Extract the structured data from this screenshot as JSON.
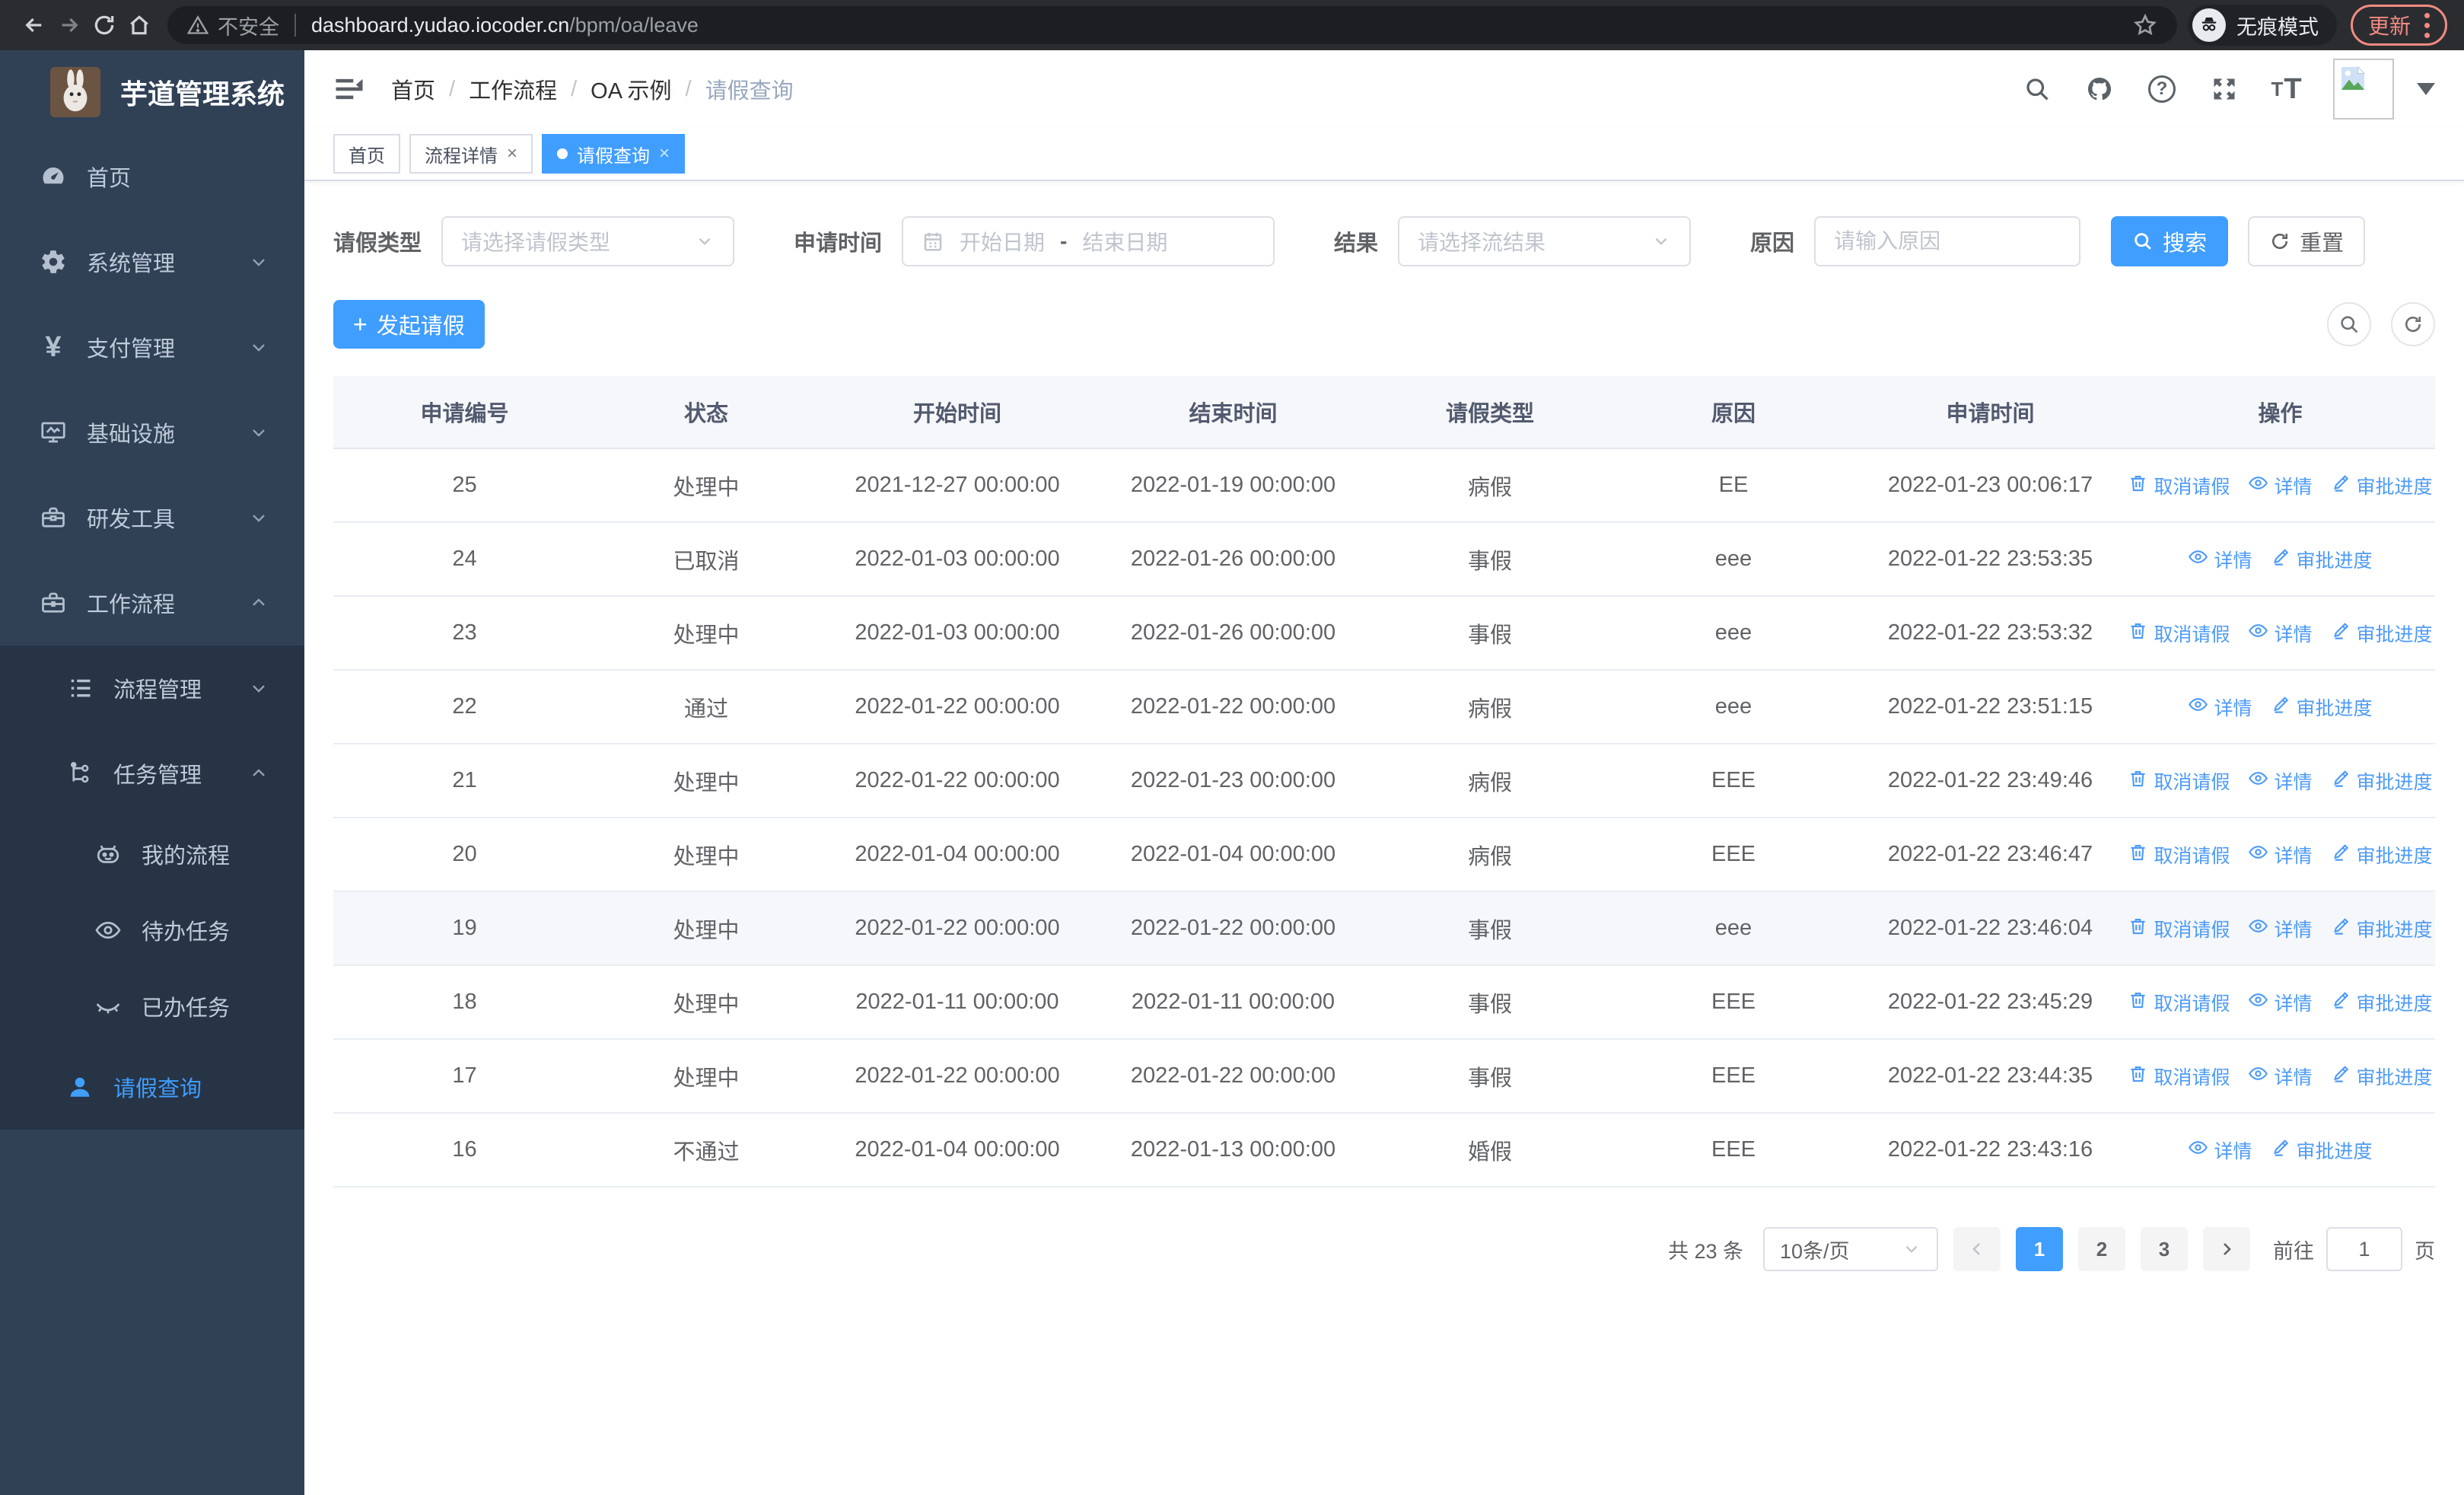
{
  "browser": {
    "security_label": "不安全",
    "url_host": "dashboard.yudao.iocoder.cn",
    "url_path": "/bpm/oa/leave",
    "incognito_label": "无痕模式",
    "update_label": "更新"
  },
  "colors": {
    "primary": "#409EFF",
    "sidebar_bg": "#304156",
    "submenu_bg": "#263445",
    "coral": "#f28b82"
  },
  "sidebar": {
    "title": "芋道管理系统",
    "items": [
      {
        "label": "首页",
        "icon": "dashboard-icon",
        "level": 1,
        "sub": false,
        "chevron": null,
        "active": false
      },
      {
        "label": "系统管理",
        "icon": "gear-icon",
        "level": 1,
        "sub": false,
        "chevron": "down",
        "active": false
      },
      {
        "label": "支付管理",
        "icon": "yen-icon",
        "level": 1,
        "sub": false,
        "chevron": "down",
        "active": false
      },
      {
        "label": "基础设施",
        "icon": "monitor-icon",
        "level": 1,
        "sub": false,
        "chevron": "down",
        "active": false
      },
      {
        "label": "研发工具",
        "icon": "toolbox-icon",
        "level": 1,
        "sub": false,
        "chevron": "down",
        "active": false
      },
      {
        "label": "工作流程",
        "icon": "briefcase-icon",
        "level": 1,
        "sub": false,
        "chevron": "up",
        "active": false
      },
      {
        "label": "流程管理",
        "icon": "tree-icon",
        "level": 2,
        "sub": true,
        "chevron": "down",
        "active": false
      },
      {
        "label": "任务管理",
        "icon": "flow-icon",
        "level": 2,
        "sub": true,
        "chevron": "up",
        "active": false
      },
      {
        "label": "我的流程",
        "icon": "robot-icon",
        "level": 3,
        "sub": true,
        "chevron": null,
        "active": false
      },
      {
        "label": "待办任务",
        "icon": "eye-open-icon",
        "level": 3,
        "sub": true,
        "chevron": null,
        "active": false
      },
      {
        "label": "已办任务",
        "icon": "eye-closed-icon",
        "level": 3,
        "sub": true,
        "chevron": null,
        "active": false
      },
      {
        "label": "请假查询",
        "icon": "user-icon",
        "level": 2,
        "sub": true,
        "chevron": null,
        "active": true
      }
    ]
  },
  "header": {
    "breadcrumb": [
      "首页",
      "工作流程",
      "OA 示例",
      "请假查询"
    ]
  },
  "tabs": [
    {
      "label": "首页",
      "closable": false,
      "active": false
    },
    {
      "label": "流程详情",
      "closable": true,
      "active": false
    },
    {
      "label": "请假查询",
      "closable": true,
      "active": true
    }
  ],
  "filters": {
    "leave_type_label": "请假类型",
    "leave_type_placeholder": "请选择请假类型",
    "apply_time_label": "申请时间",
    "date_start_placeholder": "开始日期",
    "date_separator": "-",
    "date_end_placeholder": "结束日期",
    "result_label": "结果",
    "result_placeholder": "请选择流结果",
    "reason_label": "原因",
    "reason_placeholder": "请输入原因",
    "search_label": "搜索",
    "reset_label": "重置"
  },
  "toolbar": {
    "create_label": "发起请假"
  },
  "table": {
    "columns": [
      "申请编号",
      "状态",
      "开始时间",
      "结束时间",
      "请假类型",
      "原因",
      "申请时间",
      "操作"
    ],
    "action_labels": {
      "cancel": "取消请假",
      "detail": "详情",
      "progress": "审批进度"
    },
    "rows": [
      {
        "id": "25",
        "status": "处理中",
        "start": "2021-12-27 00:00:00",
        "end": "2022-01-19 00:00:00",
        "type": "病假",
        "reason": "EE",
        "apply_time": "2022-01-23 00:06:17",
        "actions": [
          "cancel",
          "detail",
          "progress"
        ],
        "highlight": false
      },
      {
        "id": "24",
        "status": "已取消",
        "start": "2022-01-03 00:00:00",
        "end": "2022-01-26 00:00:00",
        "type": "事假",
        "reason": "eee",
        "apply_time": "2022-01-22 23:53:35",
        "actions": [
          "detail",
          "progress"
        ],
        "highlight": false
      },
      {
        "id": "23",
        "status": "处理中",
        "start": "2022-01-03 00:00:00",
        "end": "2022-01-26 00:00:00",
        "type": "事假",
        "reason": "eee",
        "apply_time": "2022-01-22 23:53:32",
        "actions": [
          "cancel",
          "detail",
          "progress"
        ],
        "highlight": false
      },
      {
        "id": "22",
        "status": "通过",
        "start": "2022-01-22 00:00:00",
        "end": "2022-01-22 00:00:00",
        "type": "病假",
        "reason": "eee",
        "apply_time": "2022-01-22 23:51:15",
        "actions": [
          "detail",
          "progress"
        ],
        "highlight": false
      },
      {
        "id": "21",
        "status": "处理中",
        "start": "2022-01-22 00:00:00",
        "end": "2022-01-23 00:00:00",
        "type": "病假",
        "reason": "EEE",
        "apply_time": "2022-01-22 23:49:46",
        "actions": [
          "cancel",
          "detail",
          "progress"
        ],
        "highlight": false
      },
      {
        "id": "20",
        "status": "处理中",
        "start": "2022-01-04 00:00:00",
        "end": "2022-01-04 00:00:00",
        "type": "病假",
        "reason": "EEE",
        "apply_time": "2022-01-22 23:46:47",
        "actions": [
          "cancel",
          "detail",
          "progress"
        ],
        "highlight": false
      },
      {
        "id": "19",
        "status": "处理中",
        "start": "2022-01-22 00:00:00",
        "end": "2022-01-22 00:00:00",
        "type": "事假",
        "reason": "eee",
        "apply_time": "2022-01-22 23:46:04",
        "actions": [
          "cancel",
          "detail",
          "progress"
        ],
        "highlight": true
      },
      {
        "id": "18",
        "status": "处理中",
        "start": "2022-01-11 00:00:00",
        "end": "2022-01-11 00:00:00",
        "type": "事假",
        "reason": "EEE",
        "apply_time": "2022-01-22 23:45:29",
        "actions": [
          "cancel",
          "detail",
          "progress"
        ],
        "highlight": false
      },
      {
        "id": "17",
        "status": "处理中",
        "start": "2022-01-22 00:00:00",
        "end": "2022-01-22 00:00:00",
        "type": "事假",
        "reason": "EEE",
        "apply_time": "2022-01-22 23:44:35",
        "actions": [
          "cancel",
          "detail",
          "progress"
        ],
        "highlight": false
      },
      {
        "id": "16",
        "status": "不通过",
        "start": "2022-01-04 00:00:00",
        "end": "2022-01-13 00:00:00",
        "type": "婚假",
        "reason": "EEE",
        "apply_time": "2022-01-22 23:43:16",
        "actions": [
          "detail",
          "progress"
        ],
        "highlight": false
      }
    ]
  },
  "pagination": {
    "total": "共 23 条",
    "page_size": "10条/页",
    "pages": [
      "1",
      "2",
      "3"
    ],
    "active_page": "1",
    "goto_label": "前往",
    "goto_value": "1",
    "goto_unit": "页"
  }
}
